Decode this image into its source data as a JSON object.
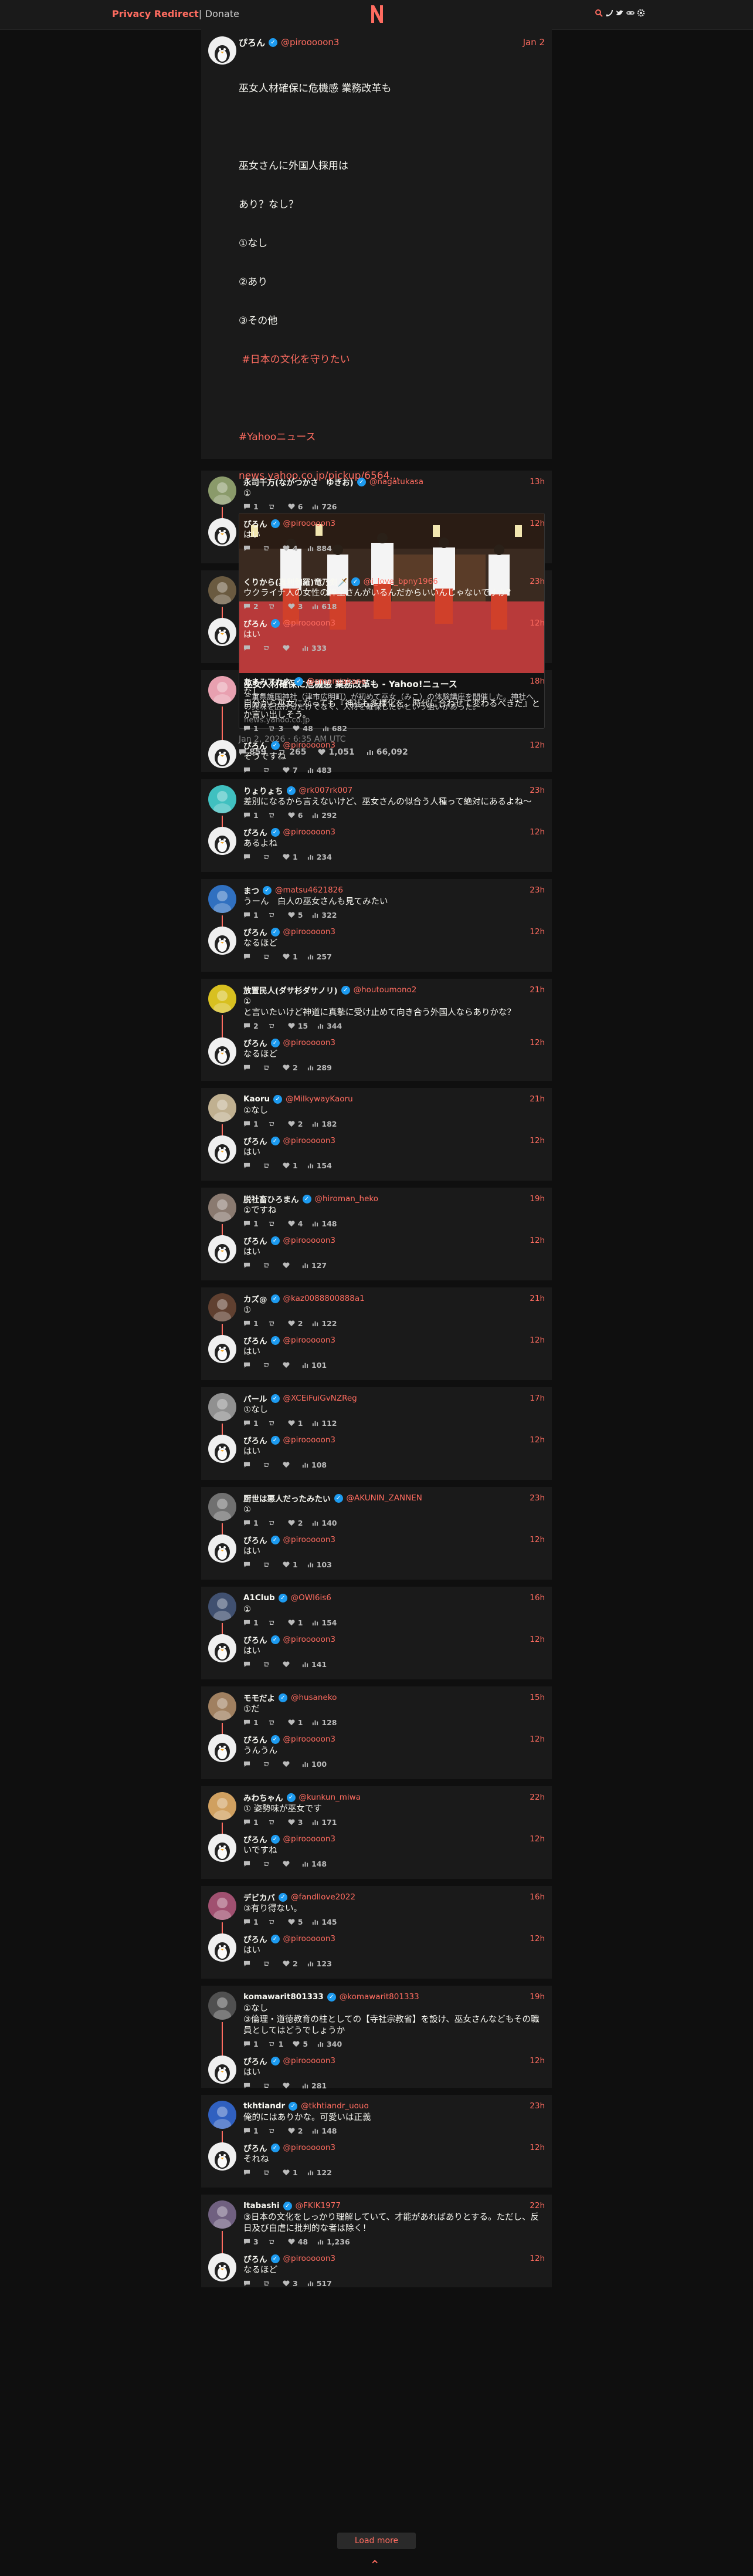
{
  "nav": {
    "brand": "Privacy Redirect",
    "sep": "|",
    "donate": "Donate",
    "logo_letter": "N",
    "icons": [
      "search-icon",
      "rss-icon",
      "twitter-bird-icon",
      "link-icon",
      "gear-icon"
    ]
  },
  "main_tweet": {
    "fullname": "ぴろん",
    "username": "@pirooooon3",
    "date": "Jan 2",
    "text_lines": [
      "巫女人材確保に危機感 業務改革も",
      "",
      "巫女さんに外国人採用は",
      "あり？なし？",
      "①なし",
      "②あり",
      "③その他"
    ],
    "hashtag_line": "#日本の文化を守りたい",
    "hashtag2": "#Yahooニュース",
    "link": "news.yahoo.co.jp/pickup/6564...",
    "card": {
      "title": "巫女人材確保に危機感 業務改革も - Yahoo!ニュース",
      "description": "三重県護国神社（津市広明町）が初めて巫女（みこ）の体験講座を開催した。神社への興味を広げるだけでなく、人材を確保したいという狙いがあった。",
      "destination": "news.yahoo.co.jp"
    },
    "published": "Jan 2, 2026 · 6:35 AM UTC",
    "stats": {
      "replies": "859",
      "retweets": "265",
      "likes": "1,051",
      "views": "66,092"
    }
  },
  "threads": [
    {
      "reply": {
        "fullname": "永司千万(ながつかさ　ゆきお)",
        "username": "@nagatukasa",
        "date": "13h",
        "text": "①",
        "replies": "1",
        "retweets": "",
        "likes": "6",
        "views": "726",
        "avatar_color": "#8a9a6a"
      },
      "answer": {
        "fullname": "ぴろん",
        "username": "@pirooooon3",
        "date": "12h",
        "text": "はい",
        "replies": "",
        "retweets": "",
        "likes": "4",
        "views": "884"
      }
    },
    {
      "reply": {
        "fullname": "くりから(真利伽羅)竜乃剣🗡️",
        "username": "@i_love_bpny1966",
        "date": "23h",
        "text": "ウクライナ人の女性の神主さんがいるんだからいいんじゃないですか？",
        "replies": "2",
        "retweets": "",
        "likes": "3",
        "views": "618",
        "avatar_color": "#6a5a40"
      },
      "answer": {
        "fullname": "ぴろん",
        "username": "@pirooooon3",
        "date": "12h",
        "text": "はい",
        "replies": "",
        "retweets": "",
        "likes": "",
        "views": "333"
      }
    },
    {
      "reply": {
        "fullname": "あまみアカネ",
        "username": "@amamiakane",
        "date": "18h",
        "text": "なし。\n自分から巫女になっても『神社も多様化を。時代に合わせて変わるべきだ』とか言い出しそう。",
        "replies": "1",
        "retweets": "3",
        "likes": "48",
        "views": "682",
        "avatar_color": "#e8a0b0"
      },
      "answer": {
        "fullname": "ぴろん",
        "username": "@pirooooon3",
        "date": "12h",
        "text": "そうですね",
        "replies": "",
        "retweets": "",
        "likes": "7",
        "views": "483"
      }
    },
    {
      "reply": {
        "fullname": "りょりょち",
        "username": "@rk007rk007",
        "date": "23h",
        "text": "差別になるから言えないけど、巫女さんの似合う人種って絶対にあるよね〜",
        "replies": "1",
        "retweets": "",
        "likes": "6",
        "views": "292",
        "avatar_color": "#40c0c0"
      },
      "answer": {
        "fullname": "ぴろん",
        "username": "@pirooooon3",
        "date": "12h",
        "text": "あるよね",
        "replies": "",
        "retweets": "",
        "likes": "1",
        "views": "234"
      }
    },
    {
      "reply": {
        "fullname": "まつ",
        "username": "@matsu4621826",
        "date": "23h",
        "text": "うーん　白人の巫女さんも見てみたい",
        "replies": "1",
        "retweets": "",
        "likes": "5",
        "views": "322",
        "avatar_color": "#3070c0"
      },
      "answer": {
        "fullname": "ぴろん",
        "username": "@pirooooon3",
        "date": "12h",
        "text": "なるほど",
        "replies": "",
        "retweets": "",
        "likes": "1",
        "views": "257"
      }
    },
    {
      "reply": {
        "fullname": "放置民人(ダサ杉ダサノリ)",
        "username": "@houtoumono2",
        "date": "21h",
        "text": "①\nと言いたいけど神道に真摯に受け止めて向き合う外国人ならありかな？",
        "replies": "2",
        "retweets": "",
        "likes": "15",
        "views": "344",
        "avatar_color": "#d8c020"
      },
      "answer": {
        "fullname": "ぴろん",
        "username": "@pirooooon3",
        "date": "12h",
        "text": "なるほど",
        "replies": "",
        "retweets": "",
        "likes": "2",
        "views": "289"
      }
    },
    {
      "reply": {
        "fullname": "Kaoru",
        "username": "@MilkywayKaoru",
        "date": "21h",
        "text": "①なし",
        "replies": "1",
        "retweets": "",
        "likes": "2",
        "views": "182",
        "avatar_color": "#c0b090"
      },
      "answer": {
        "fullname": "ぴろん",
        "username": "@pirooooon3",
        "date": "12h",
        "text": "はい",
        "replies": "",
        "retweets": "",
        "likes": "1",
        "views": "154"
      }
    },
    {
      "reply": {
        "fullname": "脱社畜ひろまん",
        "username": "@hiroman_heko",
        "date": "19h",
        "text": "①ですね",
        "replies": "1",
        "retweets": "",
        "likes": "4",
        "views": "148",
        "avatar_color": "#8a7a70"
      },
      "answer": {
        "fullname": "ぴろん",
        "username": "@pirooooon3",
        "date": "12h",
        "text": "はい",
        "replies": "",
        "retweets": "",
        "likes": "",
        "views": "127"
      }
    },
    {
      "reply": {
        "fullname": "カズ@",
        "username": "@kaz0088800888a1",
        "date": "21h",
        "text": "①",
        "replies": "1",
        "retweets": "",
        "likes": "2",
        "views": "122",
        "avatar_color": "#604030"
      },
      "answer": {
        "fullname": "ぴろん",
        "username": "@pirooooon3",
        "date": "12h",
        "text": "はい",
        "replies": "",
        "retweets": "",
        "likes": "",
        "views": "101"
      }
    },
    {
      "reply": {
        "fullname": "パール",
        "username": "@XCEiFuiGvNZReg",
        "date": "17h",
        "text": "①なし",
        "replies": "1",
        "retweets": "",
        "likes": "1",
        "views": "112",
        "avatar_color": "#909090"
      },
      "answer": {
        "fullname": "ぴろん",
        "username": "@pirooooon3",
        "date": "12h",
        "text": "はい",
        "replies": "",
        "retweets": "",
        "likes": "",
        "views": "108"
      }
    },
    {
      "reply": {
        "fullname": "厨世は悪人だったみたい",
        "username": "@AKUNIN_ZANNEN",
        "date": "23h",
        "text": "①",
        "replies": "1",
        "retweets": "",
        "likes": "2",
        "views": "140",
        "avatar_color": "#707070"
      },
      "answer": {
        "fullname": "ぴろん",
        "username": "@pirooooon3",
        "date": "12h",
        "text": "はい",
        "replies": "",
        "retweets": "",
        "likes": "1",
        "views": "103"
      }
    },
    {
      "reply": {
        "fullname": "A1Club",
        "username": "@OWl6is6",
        "date": "16h",
        "text": "①",
        "replies": "1",
        "retweets": "",
        "likes": "1",
        "views": "154",
        "avatar_color": "#405070"
      },
      "answer": {
        "fullname": "ぴろん",
        "username": "@pirooooon3",
        "date": "12h",
        "text": "はい",
        "replies": "",
        "retweets": "",
        "likes": "",
        "views": "141"
      }
    },
    {
      "reply": {
        "fullname": "モモだよ",
        "username": "@husaneko",
        "date": "15h",
        "text": "①だ",
        "replies": "1",
        "retweets": "",
        "likes": "1",
        "views": "128",
        "avatar_color": "#a08060"
      },
      "answer": {
        "fullname": "ぴろん",
        "username": "@pirooooon3",
        "date": "12h",
        "text": "うんうん",
        "replies": "",
        "retweets": "",
        "likes": "",
        "views": "100"
      }
    },
    {
      "reply": {
        "fullname": "みわちゃん",
        "username": "@kunkun_miwa",
        "date": "22h",
        "text": "① 姿勢味が巫女です",
        "replies": "1",
        "retweets": "",
        "likes": "3",
        "views": "171",
        "avatar_color": "#d0a060"
      },
      "answer": {
        "fullname": "ぴろん",
        "username": "@pirooooon3",
        "date": "12h",
        "text": "いですね",
        "replies": "",
        "retweets": "",
        "likes": "",
        "views": "148"
      }
    },
    {
      "reply": {
        "fullname": "デビカバ",
        "username": "@fandllove2022",
        "date": "16h",
        "text": "③有り得ない。",
        "replies": "1",
        "retweets": "",
        "likes": "5",
        "views": "145",
        "avatar_color": "#a05070"
      },
      "answer": {
        "fullname": "ぴろん",
        "username": "@pirooooon3",
        "date": "12h",
        "text": "はい",
        "replies": "",
        "retweets": "",
        "likes": "2",
        "views": "123"
      }
    },
    {
      "reply": {
        "fullname": "komawarit801333",
        "username": "@komawarit801333",
        "date": "19h",
        "text": "①なし\n③倫理・道徳教育の柱としての【寺社宗教省】を設け、巫女さんなどもその職員としてはどうでしょうか",
        "replies": "1",
        "retweets": "1",
        "likes": "5",
        "views": "340",
        "avatar_color": "#505050"
      },
      "answer": {
        "fullname": "ぴろん",
        "username": "@pirooooon3",
        "date": "12h",
        "text": "はい",
        "replies": "",
        "retweets": "",
        "likes": "",
        "views": "281"
      }
    },
    {
      "reply": {
        "fullname": "tkhtiandr",
        "username": "@tkhtiandr_uouo",
        "date": "23h",
        "text": "俺的にはありかな。可愛いは正義",
        "replies": "1",
        "retweets": "",
        "likes": "2",
        "views": "148",
        "avatar_color": "#3060c0"
      },
      "answer": {
        "fullname": "ぴろん",
        "username": "@pirooooon3",
        "date": "12h",
        "text": "それね",
        "replies": "",
        "retweets": "",
        "likes": "1",
        "views": "122"
      }
    },
    {
      "reply": {
        "fullname": "Itabashi",
        "username": "@FKIK1977",
        "date": "22h",
        "text": "③日本の文化をしっかり理解していて、才能があればありとする。ただし、反日及び自虐に批判的な者は除く！",
        "replies": "3",
        "retweets": "",
        "likes": "48",
        "views": "1,236",
        "avatar_color": "#706080"
      },
      "answer": {
        "fullname": "ぴろん",
        "username": "@pirooooon3",
        "date": "12h",
        "text": "なるほど",
        "replies": "",
        "retweets": "",
        "likes": "3",
        "views": "517"
      }
    }
  ],
  "load_more": "Load more",
  "top_ref": "⌃"
}
